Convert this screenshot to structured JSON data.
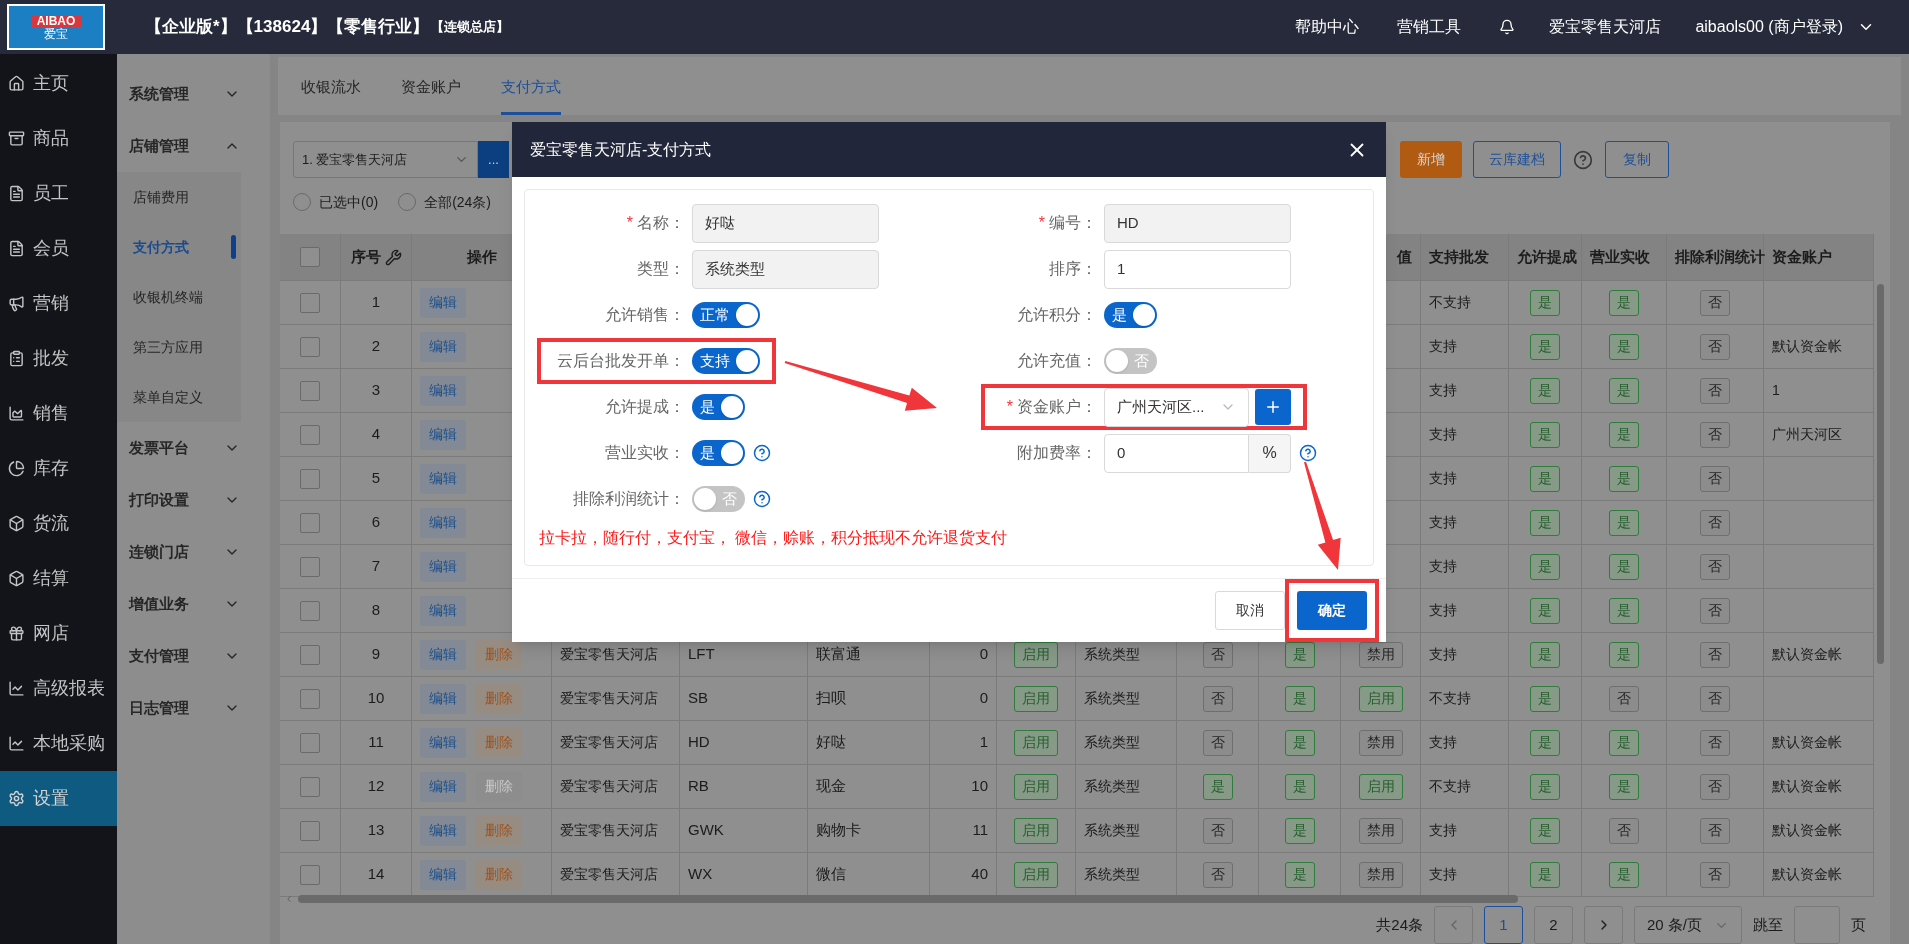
{
  "header": {
    "logo_text": "AIBAO",
    "logo_subtext": "爱宝",
    "title": "【企业版*】【138624】【零售行业】",
    "subtitle": "【连锁总店】",
    "links": [
      "帮助中心",
      "营销工具"
    ],
    "store": "爱宝零售天河店",
    "user": "aibaols00 (商户登录)"
  },
  "sidebar": {
    "items": [
      {
        "label": "主页",
        "selected": false
      },
      {
        "label": "商品",
        "selected": false
      },
      {
        "label": "员工",
        "selected": false
      },
      {
        "label": "会员",
        "selected": false
      },
      {
        "label": "营销",
        "selected": false
      },
      {
        "label": "批发",
        "selected": false
      },
      {
        "label": "销售",
        "selected": false
      },
      {
        "label": "库存",
        "selected": false
      },
      {
        "label": "货流",
        "selected": false
      },
      {
        "label": "结算",
        "selected": false
      },
      {
        "label": "网店",
        "selected": false
      },
      {
        "label": "高级报表",
        "selected": false
      },
      {
        "label": "本地采购",
        "selected": false
      },
      {
        "label": "设置",
        "selected": true
      }
    ]
  },
  "submenu": {
    "groups": [
      {
        "label": "系统管理",
        "expanded": false
      },
      {
        "label": "店铺管理",
        "expanded": true,
        "children": [
          {
            "label": "店铺费用",
            "selected": false
          },
          {
            "label": "支付方式",
            "selected": true
          },
          {
            "label": "收银机终端",
            "selected": false
          },
          {
            "label": "第三方应用",
            "selected": false
          },
          {
            "label": "菜单自定义",
            "selected": false
          }
        ]
      },
      {
        "label": "发票平台",
        "expanded": false
      },
      {
        "label": "打印设置",
        "expanded": false
      },
      {
        "label": "连锁门店",
        "expanded": false
      },
      {
        "label": "增值业务",
        "expanded": false
      },
      {
        "label": "支付管理",
        "expanded": false
      },
      {
        "label": "日志管理",
        "expanded": false
      }
    ]
  },
  "tabs": [
    {
      "label": "收银流水",
      "selected": false
    },
    {
      "label": "资金账户",
      "selected": false
    },
    {
      "label": "支付方式",
      "selected": true
    }
  ],
  "toolbar": {
    "store_select": "1. 爱宝零售天河店",
    "more_button": "...",
    "add_button": "新增",
    "cloud_button": "云库建档",
    "copy_button": "复制"
  },
  "filters": [
    {
      "label": "已选中(0)",
      "selected": false
    },
    {
      "label": "全部(24条)",
      "selected": false
    }
  ],
  "table": {
    "header": {
      "checked": false,
      "number": "序号",
      "ops": "操作",
      "recharge": "值",
      "wholesale": "支持批发",
      "commission": "允许提成",
      "revenue": "营业实收",
      "exclude": "排除利润统计",
      "account": "资金账户"
    },
    "rows": [
      {
        "checked": false,
        "number": "1",
        "edit": "编辑",
        "wholesale": "不支持",
        "commission": {
          "text": "是",
          "on": true
        },
        "revenue": {
          "text": "是",
          "on": true
        },
        "exclude": {
          "text": "否",
          "on": false
        }
      },
      {
        "checked": false,
        "number": "2",
        "edit": "编辑",
        "wholesale": "支持",
        "commission": {
          "text": "是",
          "on": true
        },
        "revenue": {
          "text": "是",
          "on": true
        },
        "exclude": {
          "text": "否",
          "on": false
        },
        "account": "默认资金帐"
      },
      {
        "checked": false,
        "number": "3",
        "edit": "编辑",
        "wholesale": "支持",
        "commission": {
          "text": "是",
          "on": true
        },
        "revenue": {
          "text": "是",
          "on": true
        },
        "exclude": {
          "text": "否",
          "on": false
        },
        "account": "1"
      },
      {
        "checked": false,
        "number": "4",
        "edit": "编辑",
        "wholesale": "支持",
        "commission": {
          "text": "是",
          "on": true
        },
        "revenue": {
          "text": "是",
          "on": true
        },
        "exclude": {
          "text": "否",
          "on": false
        },
        "account": "广州天河区"
      },
      {
        "checked": false,
        "number": "5",
        "edit": "编辑",
        "wholesale": "支持",
        "commission": {
          "text": "是",
          "on": true
        },
        "revenue": {
          "text": "是",
          "on": true
        },
        "exclude": {
          "text": "否",
          "on": false
        }
      },
      {
        "checked": false,
        "number": "6",
        "edit": "编辑",
        "wholesale": "支持",
        "commission": {
          "text": "是",
          "on": true
        },
        "revenue": {
          "text": "是",
          "on": true
        },
        "exclude": {
          "text": "否",
          "on": false
        }
      },
      {
        "checked": false,
        "number": "7",
        "edit": "编辑",
        "wholesale": "支持",
        "commission": {
          "text": "是",
          "on": true
        },
        "revenue": {
          "text": "是",
          "on": true
        },
        "exclude": {
          "text": "否",
          "on": false
        }
      },
      {
        "checked": false,
        "number": "8",
        "edit": "编辑",
        "wholesale": "支持",
        "commission": {
          "text": "是",
          "on": true
        },
        "revenue": {
          "text": "是",
          "on": true
        },
        "exclude": {
          "text": "否",
          "on": false
        }
      },
      {
        "checked": false,
        "number": "9",
        "edit": "编辑",
        "delete": {
          "text": "删除",
          "disabled": false
        },
        "store": "爱宝零售天河店",
        "code": "LFT",
        "name": "联富通",
        "sort": "0",
        "status": {
          "text": "启用",
          "on": true
        },
        "type": "系统类型",
        "column_10": {
          "text": "否",
          "on": false
        },
        "column_11": {
          "text": "是",
          "on": true
        },
        "recharge": {
          "text": "禁用",
          "on": false
        },
        "wholesale": "支持",
        "commission": {
          "text": "是",
          "on": true
        },
        "revenue": {
          "text": "是",
          "on": true
        },
        "exclude": {
          "text": "否",
          "on": false
        },
        "account": "默认资金帐"
      },
      {
        "checked": false,
        "number": "10",
        "edit": "编辑",
        "delete": {
          "text": "删除",
          "disabled": false
        },
        "store": "爱宝零售天河店",
        "code": "SB",
        "name": "扫呗",
        "sort": "0",
        "status": {
          "text": "启用",
          "on": true
        },
        "type": "系统类型",
        "column_10": {
          "text": "否",
          "on": false
        },
        "column_11": {
          "text": "是",
          "on": true
        },
        "recharge": {
          "text": "启用",
          "on": true
        },
        "wholesale": "不支持",
        "commission": {
          "text": "是",
          "on": true
        },
        "revenue": {
          "text": "否",
          "on": false
        },
        "exclude": {
          "text": "否",
          "on": false
        }
      },
      {
        "checked": false,
        "number": "11",
        "edit": "编辑",
        "delete": {
          "text": "删除",
          "disabled": false
        },
        "store": "爱宝零售天河店",
        "code": "HD",
        "name": "好哒",
        "sort": "1",
        "status": {
          "text": "启用",
          "on": true
        },
        "type": "系统类型",
        "column_10": {
          "text": "否",
          "on": false
        },
        "column_11": {
          "text": "是",
          "on": true
        },
        "recharge": {
          "text": "禁用",
          "on": false
        },
        "wholesale": "支持",
        "commission": {
          "text": "是",
          "on": true
        },
        "revenue": {
          "text": "是",
          "on": true
        },
        "exclude": {
          "text": "否",
          "on": false
        },
        "account": "默认资金帐"
      },
      {
        "checked": false,
        "number": "12",
        "edit": "编辑",
        "delete": {
          "text": "删除",
          "disabled": true
        },
        "store": "爱宝零售天河店",
        "code": "RB",
        "name": "现金",
        "sort": "10",
        "status": {
          "text": "启用",
          "on": true
        },
        "type": "系统类型",
        "column_10": {
          "text": "是",
          "on": true
        },
        "column_11": {
          "text": "是",
          "on": true
        },
        "recharge": {
          "text": "启用",
          "on": true
        },
        "wholesale": "不支持",
        "commission": {
          "text": "是",
          "on": true
        },
        "revenue": {
          "text": "是",
          "on": true
        },
        "exclude": {
          "text": "否",
          "on": false
        },
        "account": "默认资金帐"
      },
      {
        "checked": false,
        "number": "13",
        "edit": "编辑",
        "delete": {
          "text": "删除",
          "disabled": false
        },
        "store": "爱宝零售天河店",
        "code": "GWK",
        "name": "购物卡",
        "sort": "11",
        "status": {
          "text": "启用",
          "on": true
        },
        "type": "系统类型",
        "column_10": {
          "text": "否",
          "on": false
        },
        "column_11": {
          "text": "是",
          "on": true
        },
        "recharge": {
          "text": "禁用",
          "on": false
        },
        "wholesale": "支持",
        "commission": {
          "text": "是",
          "on": true
        },
        "revenue": {
          "text": "否",
          "on": false
        },
        "exclude": {
          "text": "否",
          "on": false
        },
        "account": "默认资金帐"
      },
      {
        "checked": false,
        "number": "14",
        "edit": "编辑",
        "delete": {
          "text": "删除",
          "disabled": false
        },
        "store": "爱宝零售天河店",
        "code": "WX",
        "name": "微信",
        "sort": "40",
        "status": {
          "text": "启用",
          "on": true
        },
        "type": "系统类型",
        "column_10": {
          "text": "否",
          "on": false
        },
        "column_11": {
          "text": "是",
          "on": true
        },
        "recharge": {
          "text": "禁用",
          "on": false
        },
        "wholesale": "支持",
        "commission": {
          "text": "是",
          "on": true
        },
        "revenue": {
          "text": "是",
          "on": true
        },
        "exclude": {
          "text": "否",
          "on": false
        },
        "account": "默认资金帐"
      }
    ]
  },
  "pagination": {
    "total": "共24条",
    "pages": [
      {
        "label": "1",
        "selected": true
      },
      {
        "label": "2",
        "selected": false
      }
    ],
    "page_size": "20 条/页",
    "jump_label": "跳至",
    "page_unit": "页"
  },
  "modal": {
    "title": "爱宝零售天河店-支付方式",
    "left_fields": [
      {
        "kind": "input",
        "required_mark": "*",
        "label": "名称：",
        "value": "好哒",
        "disabled": true
      },
      {
        "kind": "input",
        "label": "类型：",
        "value": "系统类型",
        "disabled": true
      },
      {
        "kind": "switch",
        "label": "允许销售：",
        "on": true,
        "text": "正常"
      },
      {
        "kind": "switch",
        "label": "云后台批发开单：",
        "on": true,
        "text": "支持",
        "highlighted": true
      },
      {
        "kind": "switch",
        "label": "允许提成：",
        "on": true,
        "text": "是"
      },
      {
        "kind": "switch",
        "label": "营业实收：",
        "on": true,
        "text": "是",
        "help": true
      },
      {
        "kind": "switch",
        "label": "排除利润统计：",
        "on": false,
        "text": "否",
        "help": true
      }
    ],
    "right_fields": [
      {
        "kind": "input",
        "required_mark": "*",
        "label": "编号：",
        "value": "HD",
        "disabled": true
      },
      {
        "kind": "input",
        "label": "排序：",
        "value": "1",
        "disabled": false
      },
      {
        "kind": "switch",
        "label": "允许积分：",
        "on": true,
        "text": "是"
      },
      {
        "kind": "switch",
        "label": "允许充值：",
        "on": false,
        "text": "否"
      },
      {
        "kind": "select",
        "required_mark": "*",
        "label": "资金账户：",
        "value": "广州天河区...",
        "highlighted": true
      },
      {
        "kind": "input",
        "label": "附加费率：",
        "value": "0",
        "disabled": false,
        "suffix": "%",
        "help": true
      }
    ],
    "note": "拉卡拉，随行付，支付宝， 微信，赊账，积分抵现不允许退货支付",
    "cancel_button": "取消",
    "confirm_button": {
      "label": "确定",
      "highlighted": true
    }
  }
}
